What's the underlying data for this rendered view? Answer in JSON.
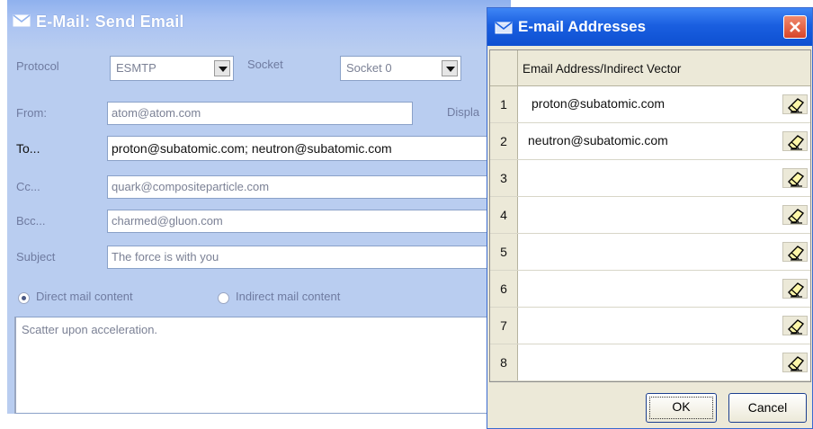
{
  "send_email": {
    "title": "E-Mail: Send Email",
    "protocol_label": "Protocol",
    "protocol_value": "ESMTP",
    "socket_label": "Socket",
    "socket_value": "Socket 0",
    "from_label": "From:",
    "from_value": "atom@atom.com",
    "display_label": "Displa",
    "to_label": "To...",
    "to_value": "proton@subatomic.com; neutron@subatomic.com",
    "cc_label": "Cc...",
    "cc_value": "quark@compositeparticle.com",
    "bcc_label": "Bcc...",
    "bcc_value": "charmed@gluon.com",
    "subject_label": "Subject",
    "subject_value": "The force is with you",
    "radio_direct": "Direct mail content",
    "radio_indirect": "Indirect mail content",
    "body_text": "Scatter upon acceleration."
  },
  "addresses": {
    "title": "E-mail Addresses",
    "column_header": "Email Address/Indirect Vector",
    "rows": [
      {
        "num": "1",
        "value": "proton@subatomic.com"
      },
      {
        "num": "2",
        "value": "neutron@subatomic.com"
      },
      {
        "num": "3",
        "value": ""
      },
      {
        "num": "4",
        "value": ""
      },
      {
        "num": "5",
        "value": ""
      },
      {
        "num": "6",
        "value": ""
      },
      {
        "num": "7",
        "value": ""
      },
      {
        "num": "8",
        "value": ""
      }
    ],
    "ok_label": "OK",
    "cancel_label": "Cancel"
  },
  "colors": {
    "send_dialog_bg": "#b9cdf0",
    "xp_titlebar": "#1a5fe0",
    "close_red": "#d8452a",
    "dialog_face": "#ece9d8"
  },
  "icons": {
    "title_icon": "envelope-icon",
    "row_action": "eraser-icon",
    "close": "close-icon"
  }
}
